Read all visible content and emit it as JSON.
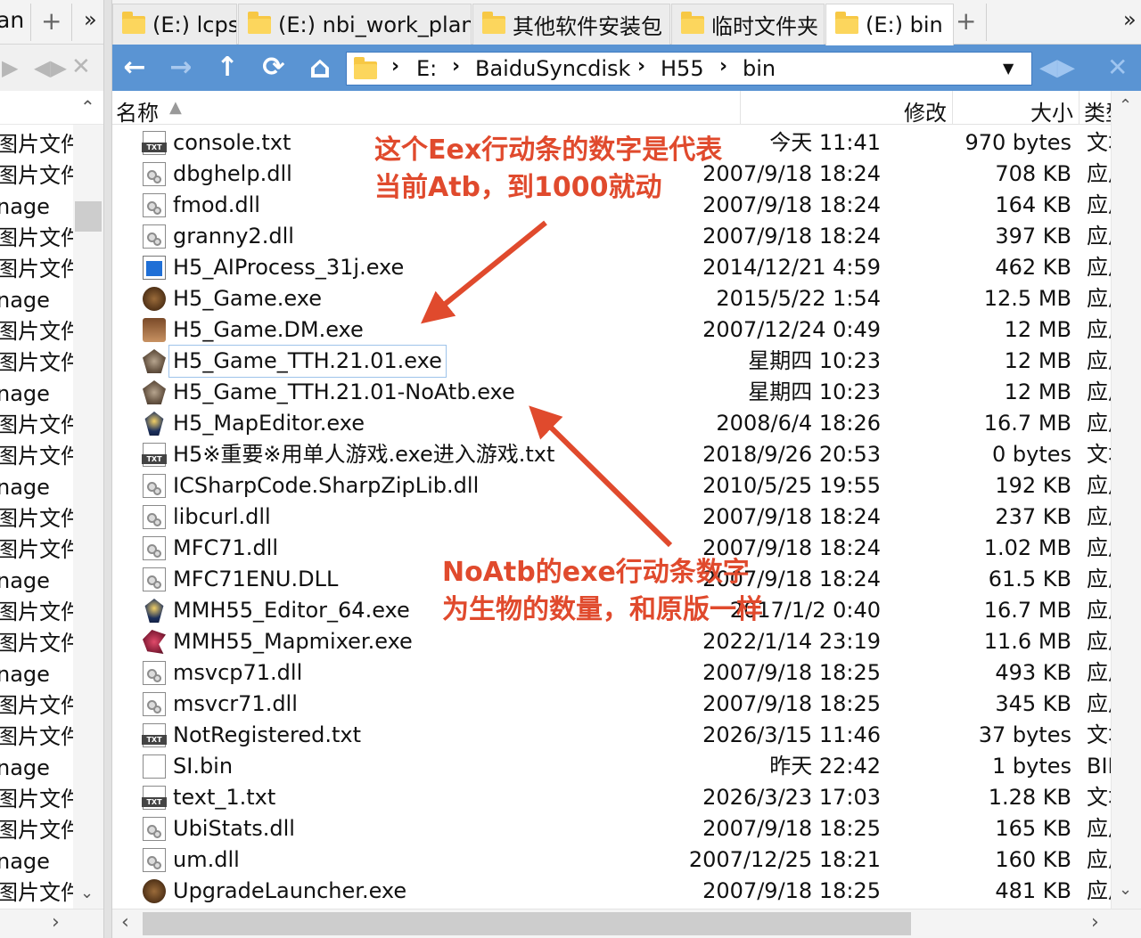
{
  "left_pane": {
    "tab_text": "an",
    "plus_glyph": "+",
    "more_glyph": "»",
    "rows": [
      "图片文件",
      "图片文件",
      "nage",
      "图片文件",
      "图片文件",
      "nage",
      "图片文件",
      "图片文件",
      "nage",
      "图片文件",
      "图片文件",
      "nage",
      "图片文件",
      "图片文件",
      "nage",
      "图片文件",
      "图片文件",
      "nage",
      "图片文件",
      "图片文件",
      "nage",
      "图片文件",
      "图片文件",
      "nage",
      "图片文件"
    ]
  },
  "tabs": [
    {
      "label": "(E:) lcps",
      "active": false
    },
    {
      "label": "(E:) nbi_work_plan",
      "active": false
    },
    {
      "label": "其他软件安装包",
      "active": false
    },
    {
      "label": "临时文件夹",
      "active": false
    },
    {
      "label": "(E:) bin",
      "active": true
    }
  ],
  "tab_bar": {
    "new_tab": "+",
    "more": "»"
  },
  "nav": {
    "back": "←",
    "forward": "→",
    "up": "↑",
    "refresh": "⟳",
    "home": "⌂",
    "breadcrumb": [
      "E:",
      "BaiduSyncdisk",
      "H55",
      "bin"
    ],
    "separator": "›",
    "dropdown": "▼"
  },
  "columns": {
    "name": "名称",
    "sort_indicator": "▲",
    "modified": "修改",
    "size": "大小",
    "type": "类型"
  },
  "files": [
    {
      "icon": "txt-file-icon",
      "name": "console.txt",
      "date": "今天 11:41",
      "size": "970 bytes",
      "type": "文本"
    },
    {
      "icon": "dll-file-icon",
      "name": "dbghelp.dll",
      "date": "2007/9/18 18:24",
      "size": "708 KB",
      "type": "应用"
    },
    {
      "icon": "dll-file-icon",
      "name": "fmod.dll",
      "date": "2007/9/18 18:24",
      "size": "164 KB",
      "type": "应用"
    },
    {
      "icon": "dll-file-icon",
      "name": "granny2.dll",
      "date": "2007/9/18 18:24",
      "size": "397 KB",
      "type": "应用"
    },
    {
      "icon": "app-window-icon",
      "name": "H5_AIProcess_31j.exe",
      "date": "2014/12/21 4:59",
      "size": "462 KB",
      "type": "应用"
    },
    {
      "icon": "game-emblem-icon",
      "name": "H5_Game.exe",
      "date": "2015/5/22 1:54",
      "size": "12.5 MB",
      "type": "应用"
    },
    {
      "icon": "hero-portrait-icon",
      "name": "H5_Game.DM.exe",
      "date": "2007/12/24 0:49",
      "size": "12 MB",
      "type": "应用"
    },
    {
      "icon": "tth-emblem-icon",
      "name": "H5_Game_TTH.21.01.exe",
      "date": "星期四 10:23",
      "size": "12 MB",
      "type": "应用",
      "focused": true
    },
    {
      "icon": "tth-emblem-icon",
      "name": "H5_Game_TTH.21.01-NoAtb.exe",
      "date": "星期四 10:23",
      "size": "12 MB",
      "type": "应用"
    },
    {
      "icon": "map-editor-icon",
      "name": "H5_MapEditor.exe",
      "date": "2008/6/4 18:26",
      "size": "16.7 MB",
      "type": "应用"
    },
    {
      "icon": "txt-file-icon",
      "name": "H5※重要※用单人游戏.exe进入游戏.txt",
      "date": "2018/9/26 20:53",
      "size": "0 bytes",
      "type": "文本"
    },
    {
      "icon": "dll-file-icon",
      "name": "ICSharpCode.SharpZipLib.dll",
      "date": "2010/5/25 19:55",
      "size": "192 KB",
      "type": "应用"
    },
    {
      "icon": "dll-file-icon",
      "name": "libcurl.dll",
      "date": "2007/9/18 18:24",
      "size": "237 KB",
      "type": "应用"
    },
    {
      "icon": "dll-file-icon",
      "name": "MFC71.dll",
      "date": "2007/9/18 18:24",
      "size": "1.02 MB",
      "type": "应用"
    },
    {
      "icon": "dll-file-icon",
      "name": "MFC71ENU.DLL",
      "date": "2007/9/18 18:24",
      "size": "61.5 KB",
      "type": "应用"
    },
    {
      "icon": "map-editor-icon",
      "name": "MMH55_Editor_64.exe",
      "date": "2017/1/2 0:40",
      "size": "16.7 MB",
      "type": "应用"
    },
    {
      "icon": "mapmixer-icon",
      "name": "MMH55_Mapmixer.exe",
      "date": "2022/1/14 23:19",
      "size": "11.6 MB",
      "type": "应用"
    },
    {
      "icon": "dll-file-icon",
      "name": "msvcp71.dll",
      "date": "2007/9/18 18:25",
      "size": "493 KB",
      "type": "应用"
    },
    {
      "icon": "dll-file-icon",
      "name": "msvcr71.dll",
      "date": "2007/9/18 18:25",
      "size": "345 KB",
      "type": "应用"
    },
    {
      "icon": "txt-file-icon",
      "name": "NotRegistered.txt",
      "date": "2026/3/15 11:46",
      "size": "37 bytes",
      "type": "文本"
    },
    {
      "icon": "blank-file-icon",
      "name": "SI.bin",
      "date": "昨天 22:42",
      "size": "1 bytes",
      "type": "BIN"
    },
    {
      "icon": "txt-file-icon",
      "name": "text_1.txt",
      "date": "2026/3/23 17:03",
      "size": "1.28 KB",
      "type": "文本"
    },
    {
      "icon": "dll-file-icon",
      "name": "UbiStats.dll",
      "date": "2007/9/18 18:25",
      "size": "165 KB",
      "type": "应用"
    },
    {
      "icon": "dll-file-icon",
      "name": "um.dll",
      "date": "2007/12/25 18:21",
      "size": "160 KB",
      "type": "应用"
    },
    {
      "icon": "game-emblem-icon",
      "name": "UpgradeLauncher.exe",
      "date": "2007/9/18 18:25",
      "size": "481 KB",
      "type": "应用"
    }
  ],
  "annotations": {
    "top": [
      "这个Eex行动条的数字是代表",
      "当前Atb，到1000就动"
    ],
    "bottom": [
      "NoAtb的exe行动条数字",
      "为生物的数量，和原版一样"
    ]
  },
  "colors": {
    "accent": "#5a94d3",
    "annotation": "#e04a2d",
    "folder": "#f7c845"
  }
}
